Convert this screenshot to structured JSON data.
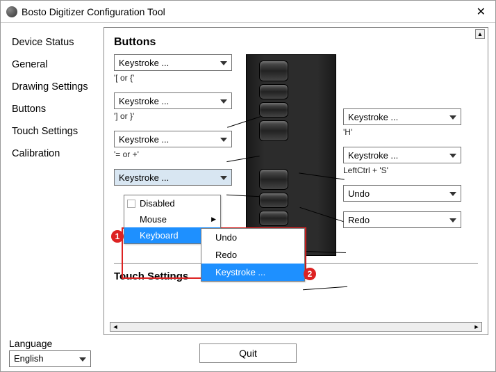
{
  "window": {
    "title": "Bosto Digitizer Configuration Tool",
    "close": "✕"
  },
  "sidebar": {
    "items": [
      {
        "label": "Device Status"
      },
      {
        "label": "General"
      },
      {
        "label": "Drawing Settings"
      },
      {
        "label": "Buttons"
      },
      {
        "label": "Touch Settings"
      },
      {
        "label": "Calibration"
      }
    ]
  },
  "section1_title": "Buttons",
  "left_buttons": [
    {
      "combo": "Keystroke ...",
      "caption": "'[ or {'"
    },
    {
      "combo": "Keystroke ...",
      "caption": "'] or }'"
    },
    {
      "combo": "Keystroke ...",
      "caption": "'= or +'"
    },
    {
      "combo": "Keystroke ...",
      "caption": ""
    }
  ],
  "right_buttons": [
    {
      "combo": "Keystroke ...",
      "caption": "'H'"
    },
    {
      "combo": "Keystroke ...",
      "caption": "LeftCtrl + 'S'"
    },
    {
      "combo": "Undo",
      "caption": ""
    },
    {
      "combo": "Redo",
      "caption": ""
    }
  ],
  "dropdown": {
    "items": [
      {
        "label": "Disabled"
      },
      {
        "label": "Mouse"
      },
      {
        "label": "Keyboard"
      }
    ]
  },
  "submenu": {
    "items": [
      {
        "label": "Undo"
      },
      {
        "label": "Redo"
      },
      {
        "label": "Keystroke ..."
      }
    ]
  },
  "section2_title": "Touch Settings",
  "badges": {
    "one": "1",
    "two": "2"
  },
  "footer": {
    "language_label": "Language",
    "language_value": "English",
    "quit": "Quit"
  }
}
